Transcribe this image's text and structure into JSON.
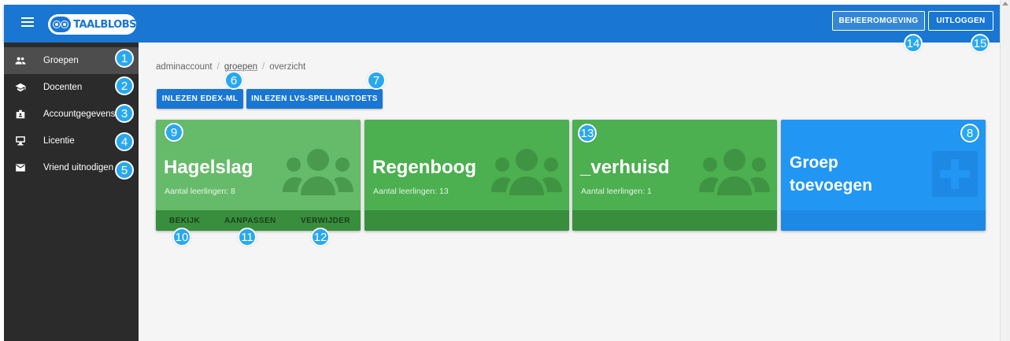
{
  "header": {
    "logo_text": "TAALBLOBS",
    "beheer_label": "BEHEEROMGEVING",
    "logout_label": "UITLOGGEN"
  },
  "sidebar": {
    "items": [
      {
        "label": "Groepen",
        "icon": "people-icon",
        "active": true
      },
      {
        "label": "Docenten",
        "icon": "school-icon",
        "active": false
      },
      {
        "label": "Accountgegevens",
        "icon": "badge-icon",
        "active": false
      },
      {
        "label": "Licentie",
        "icon": "monitor-icon",
        "active": false
      },
      {
        "label": "Vriend uitnodigen",
        "icon": "mail-icon",
        "active": false
      }
    ]
  },
  "breadcrumb": [
    "adminaccount",
    "groepen",
    "overzicht"
  ],
  "actions": {
    "edex_label": "INLEZEN EDEX-ML",
    "lvs_label": "INLEZEN LVS-SPELLINGTOETS"
  },
  "cards": [
    {
      "title": "Hagelslag",
      "subtitle": "Aantal leerlingen: 8",
      "links": [
        "BEKIJK",
        "AANPASSEN",
        "VERWIJDER"
      ]
    },
    {
      "title": "Regenboog",
      "subtitle": "Aantal leerlingen: 13"
    },
    {
      "title": "_verhuisd",
      "subtitle": "Aantal leerlingen: 1"
    }
  ],
  "add_card": {
    "title_line1": "Groep",
    "title_line2": "toevoegen"
  },
  "badges": [
    "1",
    "2",
    "3",
    "4",
    "5",
    "6",
    "7",
    "8",
    "9",
    "10",
    "11",
    "12",
    "13",
    "14",
    "15"
  ],
  "colors": {
    "primary": "#1976d2",
    "card_green": "#4caf50",
    "card_blue": "#2196f3",
    "badge": "#29a8f0",
    "sidebar": "#2b2b2b"
  }
}
